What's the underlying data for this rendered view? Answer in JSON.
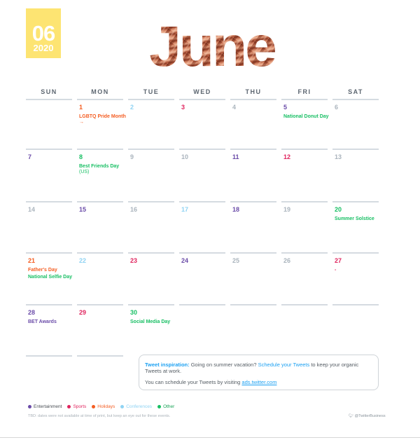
{
  "badge": {
    "month_number": "06",
    "year": "2020",
    "color": "#fde472"
  },
  "title": {
    "month_name": "June"
  },
  "weekdays": [
    "SUN",
    "MON",
    "TUE",
    "WED",
    "THU",
    "FRI",
    "SAT"
  ],
  "categories": {
    "entertainment": {
      "label": "Entertainment",
      "color": "#6a4ba8"
    },
    "sports": {
      "label": "Sports",
      "color": "#e0245e"
    },
    "holidays": {
      "label": "Holidays",
      "color": "#f45d22"
    },
    "conferences": {
      "label": "Conferences",
      "color": "#8fd3f3"
    },
    "other": {
      "label": "Other",
      "color": "#17bf63"
    },
    "none": {
      "label": "",
      "color": "#aab4bd"
    }
  },
  "weeks": [
    [
      null,
      {
        "day": "1",
        "cat": "holidays",
        "events": [
          {
            "text": "LGBTQ Pride Month →",
            "cat": "holidays"
          }
        ]
      },
      {
        "day": "2",
        "cat": "conferences",
        "events": []
      },
      {
        "day": "3",
        "cat": "sports",
        "events": []
      },
      {
        "day": "4",
        "cat": "none",
        "events": []
      },
      {
        "day": "5",
        "cat": "entertainment",
        "events": [
          {
            "text": "National Donut Day",
            "cat": "other"
          }
        ]
      },
      {
        "day": "6",
        "cat": "none",
        "events": []
      }
    ],
    [
      {
        "day": "7",
        "cat": "entertainment",
        "events": []
      },
      {
        "day": "8",
        "cat": "other",
        "events": [
          {
            "text": "Best Friends Day",
            "suffix": " (US)",
            "cat": "other"
          }
        ]
      },
      {
        "day": "9",
        "cat": "none",
        "events": []
      },
      {
        "day": "10",
        "cat": "none",
        "events": []
      },
      {
        "day": "11",
        "cat": "entertainment",
        "events": []
      },
      {
        "day": "12",
        "cat": "sports",
        "events": []
      },
      {
        "day": "13",
        "cat": "none",
        "events": []
      }
    ],
    [
      {
        "day": "14",
        "cat": "none",
        "events": []
      },
      {
        "day": "15",
        "cat": "entertainment",
        "events": []
      },
      {
        "day": "16",
        "cat": "none",
        "events": []
      },
      {
        "day": "17",
        "cat": "conferences",
        "events": []
      },
      {
        "day": "18",
        "cat": "entertainment",
        "events": []
      },
      {
        "day": "19",
        "cat": "none",
        "events": []
      },
      {
        "day": "20",
        "cat": "other",
        "events": [
          {
            "text": "Summer Solstice",
            "cat": "other"
          }
        ]
      }
    ],
    [
      {
        "day": "21",
        "cat": "holidays",
        "events": [
          {
            "text": "Father's Day",
            "cat": "holidays"
          },
          {
            "text": "National Selfie Day",
            "cat": "other"
          }
        ]
      },
      {
        "day": "22",
        "cat": "conferences",
        "events": []
      },
      {
        "day": "23",
        "cat": "sports",
        "events": []
      },
      {
        "day": "24",
        "cat": "entertainment",
        "events": []
      },
      {
        "day": "25",
        "cat": "none",
        "events": []
      },
      {
        "day": "26",
        "cat": "none",
        "events": []
      },
      {
        "day": "27",
        "cat": "sports",
        "events": [
          {
            "text": "-",
            "cat": "sports"
          }
        ]
      }
    ],
    [
      {
        "day": "28",
        "cat": "entertainment",
        "events": [
          {
            "text": "BET Awards",
            "cat": "entertainment"
          }
        ]
      },
      {
        "day": "29",
        "cat": "sports",
        "events": []
      },
      {
        "day": "30",
        "cat": "other",
        "events": [
          {
            "text": "Social Media Day",
            "cat": "other"
          }
        ]
      },
      null,
      null,
      null,
      null
    ]
  ],
  "tip": {
    "label": "Tweet inspiration:",
    "text1": " Going on summer vacation? ",
    "link": "Schedule your Tweets",
    "text2": " to keep your organic Tweets at work.",
    "line2": "You can schedule your Tweets by visiting ",
    "url": "ads.twitter.com"
  },
  "legend": [
    "entertainment",
    "sports",
    "holidays",
    "conferences",
    "other"
  ],
  "note": "TBD: dates were not available at time of print, but keep an eye out for these events.",
  "handle": {
    "icon": "twitter-bird-icon",
    "text": "@TwitterBusiness"
  }
}
